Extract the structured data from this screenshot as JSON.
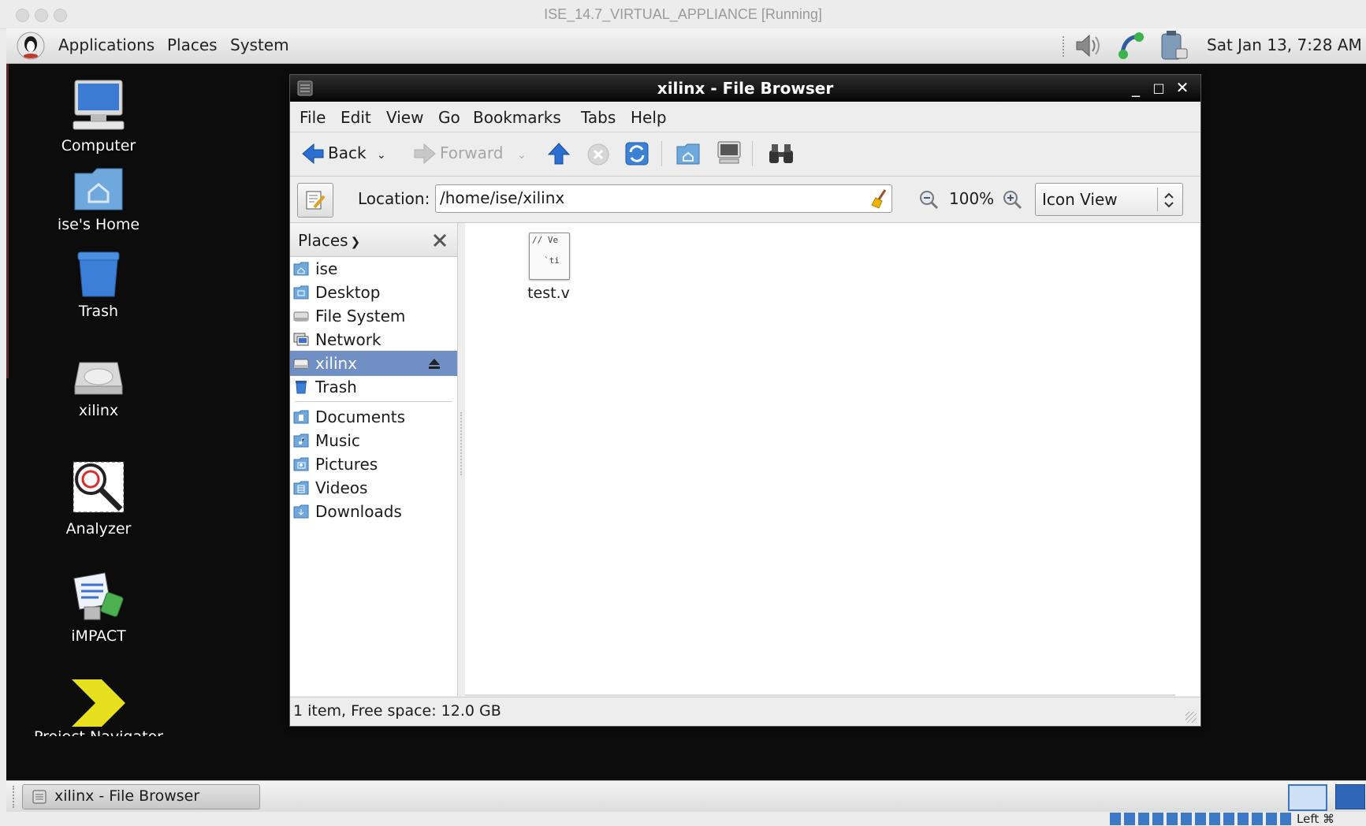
{
  "vbox": {
    "title": "ISE_14.7_VIRTUAL_APPLIANCE [Running]",
    "host_key": "Left ⌘"
  },
  "panel": {
    "menus": [
      "Applications",
      "Places",
      "System"
    ],
    "clock": "Sat Jan 13,  7:28 AM",
    "icons": [
      "volume-icon",
      "network-icon",
      "battery-icon"
    ]
  },
  "desktop": {
    "icons": [
      {
        "label": "Computer",
        "icon": "computer-icon"
      },
      {
        "label": "ise's Home",
        "icon": "home-folder-icon"
      },
      {
        "label": "Trash",
        "icon": "trash-icon"
      },
      {
        "label": "xilinx",
        "icon": "drive-icon"
      },
      {
        "label": "Analyzer",
        "icon": "analyzer-icon"
      },
      {
        "label": "iMPACT",
        "icon": "impact-icon"
      },
      {
        "label": "Project Navigator",
        "icon": "project-navigator-icon"
      }
    ]
  },
  "file_browser": {
    "title": "xilinx - File Browser",
    "menu": [
      "File",
      "Edit",
      "View",
      "Go",
      "Bookmarks",
      "Tabs",
      "Help"
    ],
    "toolbar": {
      "back": "Back",
      "forward": "Forward"
    },
    "location": {
      "label": "Location:",
      "value": "/home/ise/xilinx"
    },
    "zoom": "100%",
    "view_mode": "Icon View",
    "sidebar": {
      "header": "Places",
      "items": [
        {
          "label": "ise",
          "icon": "home-folder-icon",
          "selected": false
        },
        {
          "label": "Desktop",
          "icon": "desktop-folder-icon",
          "selected": false
        },
        {
          "label": "File System",
          "icon": "drive-icon",
          "selected": false
        },
        {
          "label": "Network",
          "icon": "network-icon",
          "selected": false
        },
        {
          "label": "xilinx",
          "icon": "drive-icon",
          "selected": true
        },
        {
          "label": "Trash",
          "icon": "trash-icon",
          "selected": false
        },
        {
          "label": "Documents",
          "icon": "documents-folder-icon",
          "selected": false
        },
        {
          "label": "Music",
          "icon": "music-folder-icon",
          "selected": false
        },
        {
          "label": "Pictures",
          "icon": "pictures-folder-icon",
          "selected": false
        },
        {
          "label": "Videos",
          "icon": "videos-folder-icon",
          "selected": false
        },
        {
          "label": "Downloads",
          "icon": "downloads-folder-icon",
          "selected": false
        }
      ]
    },
    "files": [
      {
        "name": "test.v",
        "preview_line1": "// Ve",
        "preview_line2": "`ti"
      }
    ],
    "status": "1 item, Free space: 12.0 GB"
  },
  "taskbar": {
    "task": "xilinx - File Browser"
  },
  "colors": {
    "selection": "#6f8fc5",
    "title_bar": "#111111",
    "desktop": "#0c0c0c",
    "accent_arrow": "#2a6fd1"
  }
}
